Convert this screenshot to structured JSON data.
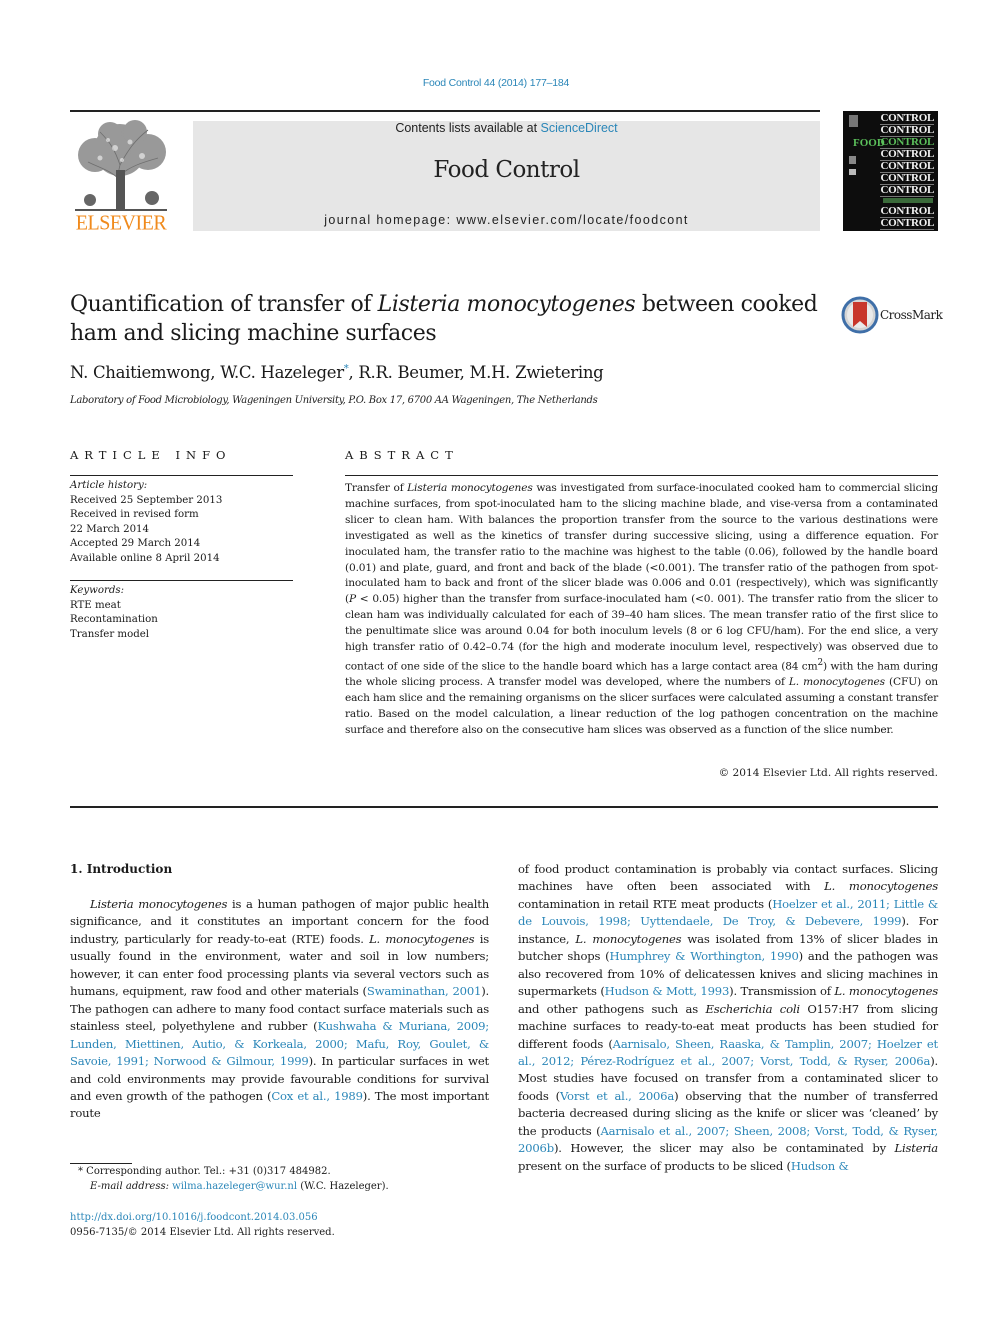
{
  "header": {
    "citation": "Food Control 44 (2014) 177–184",
    "publisher_logo_text": "ELSEVIER",
    "contents_prefix": "Contents lists available at ",
    "contents_link": "ScienceDirect",
    "journal_name": "Food Control",
    "homepage": "journal homepage: www.elsevier.com/locate/foodcont",
    "cover": {
      "words": [
        "CONTROL",
        "CONTROL",
        "CONTROL",
        "CONTROL",
        "CONTROL",
        "CONTROL",
        "CONTROL",
        "CONTROL",
        "CONTROL"
      ],
      "food_word": "FOOD"
    },
    "colors": {
      "link": "#2a86b8",
      "elsevier_orange": "#f08a1c",
      "masthead_bg": "#e6e6e6"
    }
  },
  "article": {
    "title_part1": "Quantification of transfer of ",
    "title_italic": "Listeria monocytogenes",
    "title_part2": " between cooked ham and slicing machine surfaces",
    "crossmark_label": "CrossMark",
    "authors": {
      "a1": "N. Chaitiemwong, W.C. Hazeleger",
      "a1_mark": "*",
      "a2": ", R.R. Beumer, M.H. Zwietering"
    },
    "affiliation": "Laboratory of Food Microbiology, Wageningen University, P.O. Box 17, 6700 AA Wageningen, The Netherlands"
  },
  "article_info": {
    "label": "ARTICLE INFO",
    "history_label": "Article history:",
    "history": [
      "Received 25 September 2013",
      "Received in revised form",
      "22 March 2014",
      "Accepted 29 March 2014",
      "Available online 8 April 2014"
    ],
    "keywords_label": "Keywords:",
    "keywords": [
      "RTE meat",
      "Recontamination",
      "Transfer model"
    ]
  },
  "abstract": {
    "label": "ABSTRACT",
    "p1": "Transfer of ",
    "p1_i": "Listeria monocytogenes",
    "p2": " was investigated from surface-inoculated cooked ham to commercial slicing machine surfaces, from spot-inoculated ham to the slicing machine blade, and vise-versa from a contaminated slicer to clean ham. With balances the proportion transfer from the source to the various destinations were investigated as well as the kinetics of transfer during successive slicing, using a difference equation. For inoculated ham, the transfer ratio to the machine was highest to the table (0.06), followed by the handle board (0.01) and plate, guard, and front and back of the blade (<0.001). The transfer ratio of the pathogen from spot-inoculated ham to back and front of the slicer blade was 0.006 and 0.01 (respectively), which was significantly (",
    "p2_i": "P",
    "p3": " < 0.05) higher than the transfer from surface-inoculated ham (<0. 001). The transfer ratio from the slicer to clean ham was individually calculated for each of 39–40 ham slices. The mean transfer ratio of the first slice to the penultimate slice was around 0.04 for both inoculum levels (8 or 6 log CFU/ham). For the end slice, a very high transfer ratio of 0.42–0.74 (for the high and moderate inoculum level, respectively) was observed due to contact of one side of the slice to the handle board which has a large contact area (84 cm",
    "p3_sup": "2",
    "p4": ") with the ham during the whole slicing process. A transfer model was developed, where the numbers of ",
    "p4_i": "L. monocytogenes",
    "p5": " (CFU) on each ham slice and the remaining organisms on the slicer surfaces were calculated assuming a constant transfer ratio. Based on the model calculation, a linear reduction of the log pathogen concentration on the machine surface and therefore also on the consecutive ham slices was observed as a function of the slice number.",
    "copyright": "© 2014 Elsevier Ltd. All rights reserved."
  },
  "introduction": {
    "heading": "1.  Introduction",
    "col1": [
      {
        "t": "i",
        "v": "Listeria monocytogenes"
      },
      {
        "t": "n",
        "v": " is a human pathogen of major public health significance, and it constitutes an important concern for the food industry, particularly for ready-to-eat (RTE) foods. "
      },
      {
        "t": "i",
        "v": "L. monocytogenes"
      },
      {
        "t": "n",
        "v": " is usually found in the environment, water and soil in low numbers; however, it can enter food processing plants via several vectors such as humans, equipment, raw food and other materials ("
      },
      {
        "t": "a",
        "v": "Swaminathan, 2001"
      },
      {
        "t": "n",
        "v": "). The pathogen can adhere to many food contact surface materials such as stainless steel, polyethylene and rubber ("
      },
      {
        "t": "a",
        "v": "Kushwaha & Muriana, 2009; Lunden, Miettinen, Autio, & Korkeala, 2000; Mafu, Roy, Goulet, & Savoie, 1991; Norwood & Gilmour, 1999"
      },
      {
        "t": "n",
        "v": "). In particular surfaces in wet and cold environments may provide favourable conditions for survival and even growth of the pathogen ("
      },
      {
        "t": "a",
        "v": "Cox et al., 1989"
      },
      {
        "t": "n",
        "v": "). The most important route"
      }
    ],
    "col2": [
      {
        "t": "n",
        "v": "of food product contamination is probably via contact surfaces. Slicing machines have often been associated with "
      },
      {
        "t": "i",
        "v": "L. monocytogenes"
      },
      {
        "t": "n",
        "v": " contamination in retail RTE meat products ("
      },
      {
        "t": "a",
        "v": "Hoelzer et al., 2011; Little & de Louvois, 1998; Uyttendaele, De Troy, & Debevere, 1999"
      },
      {
        "t": "n",
        "v": "). For instance, "
      },
      {
        "t": "i",
        "v": "L. monocytogenes"
      },
      {
        "t": "n",
        "v": " was isolated from 13% of slicer blades in butcher shops ("
      },
      {
        "t": "a",
        "v": "Humphrey & Worthington, 1990"
      },
      {
        "t": "n",
        "v": ") and the pathogen was also recovered from 10% of delicatessen knives and slicing machines in supermarkets ("
      },
      {
        "t": "a",
        "v": "Hudson & Mott, 1993"
      },
      {
        "t": "n",
        "v": "). Transmission of "
      },
      {
        "t": "i",
        "v": "L. monocytogenes"
      },
      {
        "t": "n",
        "v": " and other pathogens such as "
      },
      {
        "t": "i",
        "v": "Escherichia coli"
      },
      {
        "t": "n",
        "v": " O157:H7 from slicing machine surfaces to ready-to-eat meat products has been studied for different foods ("
      },
      {
        "t": "a",
        "v": "Aarnisalo, Sheen, Raaska, & Tamplin, 2007; Hoelzer et al., 2012; Pérez-Rodríguez et al., 2007; Vorst, Todd, & Ryser, 2006a"
      },
      {
        "t": "n",
        "v": "). Most studies have focused on transfer from a contaminated slicer to foods ("
      },
      {
        "t": "a",
        "v": "Vorst et al., 2006a"
      },
      {
        "t": "n",
        "v": ") observing that the number of transferred bacteria decreased during slicing as the knife or slicer was ‘cleaned’ by the products ("
      },
      {
        "t": "a",
        "v": "Aarnisalo et al., 2007; Sheen, 2008; Vorst, Todd, & Ryser, 2006b"
      },
      {
        "t": "n",
        "v": "). However, the slicer may also be contaminated by "
      },
      {
        "t": "i",
        "v": "Listeria"
      },
      {
        "t": "n",
        "v": " present on the surface of products to be sliced ("
      },
      {
        "t": "a",
        "v": "Hudson &"
      }
    ]
  },
  "footnote": {
    "mark": "*",
    "corresponding": " Corresponding author. Tel.: +31 (0)317 484982.",
    "email_label": "E-mail address: ",
    "email": "wilma.hazeleger@wur.nl",
    "email_suffix": " (W.C. Hazeleger)."
  },
  "doi": {
    "link": "http://dx.doi.org/10.1016/j.foodcont.2014.03.056",
    "issn": "0956-7135/© 2014 Elsevier Ltd. All rights reserved."
  }
}
